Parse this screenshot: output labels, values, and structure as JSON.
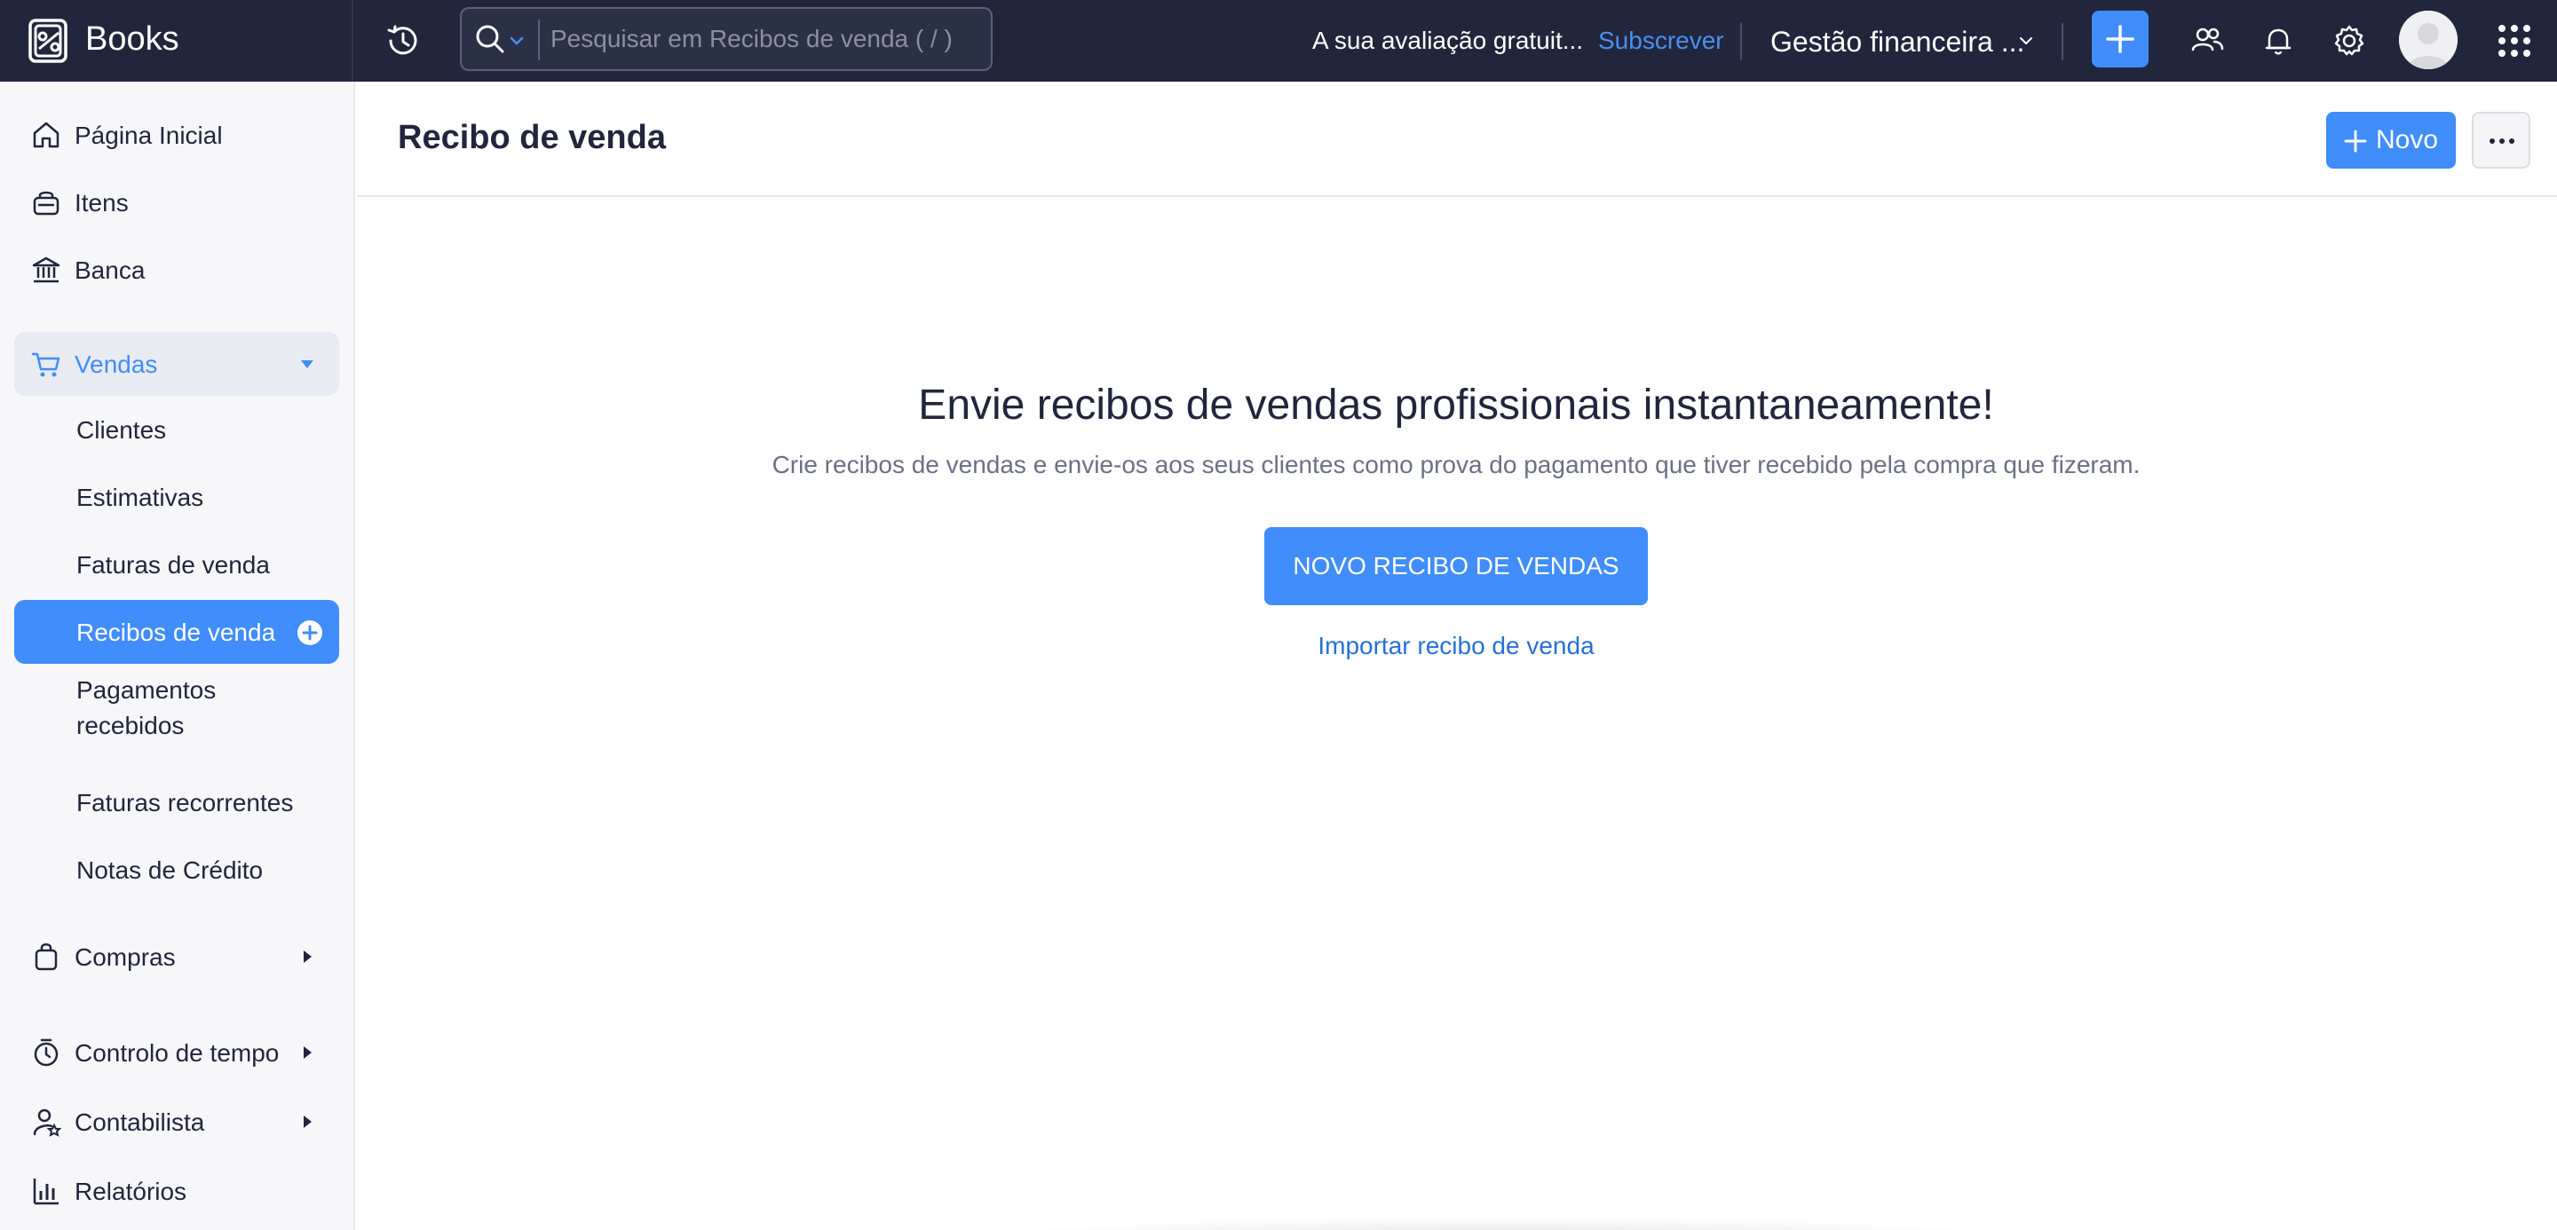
{
  "app": {
    "name": "Books"
  },
  "search": {
    "placeholder": "Pesquisar em Recibos de venda ( / )",
    "value": ""
  },
  "topbar": {
    "trial_text": "A sua avaliação gratuit...",
    "subscribe_label": "Subscrever",
    "org_name": "Gestão financeira ..."
  },
  "sidebar": {
    "items": [
      {
        "label": "Página Inicial",
        "icon": "home-icon"
      },
      {
        "label": "Itens",
        "icon": "basket-icon"
      },
      {
        "label": "Banca",
        "icon": "bank-icon"
      },
      {
        "label": "Vendas",
        "icon": "cart-icon",
        "expanded": true
      },
      {
        "label": "Compras",
        "icon": "bag-icon"
      },
      {
        "label": "Controlo de tempo",
        "icon": "timer-icon"
      },
      {
        "label": "Contabilista",
        "icon": "accountant-icon"
      },
      {
        "label": "Relatórios",
        "icon": "bar-chart-icon"
      }
    ],
    "sales_subitems": [
      {
        "label": "Clientes"
      },
      {
        "label": "Estimativas"
      },
      {
        "label": "Faturas de venda"
      },
      {
        "label": "Recibos de venda",
        "active": true
      },
      {
        "label": "Pagamentos recebidos"
      },
      {
        "label": "Faturas recorrentes"
      },
      {
        "label": "Notas de Crédito"
      }
    ]
  },
  "page": {
    "title": "Recibo de venda",
    "new_label": "Novo"
  },
  "empty_state": {
    "title": "Envie recibos de vendas profissionais instantaneamente!",
    "subtitle": "Crie recibos de vendas e envie-os aos seus clientes como prova do pagamento que tiver recebido pela compra que fizeram.",
    "primary_label": "NOVO RECIBO DE VENDAS",
    "import_label": "Importar recibo de venda"
  },
  "colors": {
    "topbar": "#21263c",
    "accent": "#408dfb",
    "link": "#2570d8",
    "sidebar": "#f7f7fa"
  }
}
